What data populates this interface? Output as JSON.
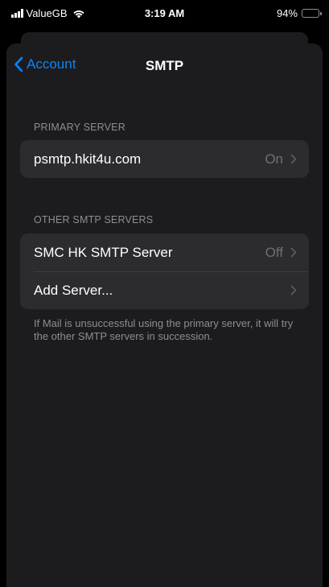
{
  "status_bar": {
    "carrier": "ValueGB",
    "time": "3:19 AM",
    "battery": "94%",
    "battery_level": 0.94
  },
  "nav": {
    "back_label": "Account",
    "title": "SMTP"
  },
  "primary_section": {
    "header": "PRIMARY SERVER",
    "rows": [
      {
        "label": "psmtp.hkit4u.com",
        "value": "On"
      }
    ]
  },
  "other_section": {
    "header": "OTHER SMTP SERVERS",
    "rows": [
      {
        "label": "SMC HK SMTP Server",
        "value": "Off"
      },
      {
        "label": "Add Server...",
        "value": ""
      }
    ],
    "footer": "If Mail is unsuccessful using the primary server, it will try the other SMTP servers in succession."
  },
  "colors": {
    "accent": "#0a84ff",
    "background": "#000000",
    "sheet": "#1c1c1e",
    "cell": "#2c2c2e",
    "secondary_text": "#8d8d93"
  },
  "icons": {
    "back": "chevron-left-icon",
    "disclosure": "chevron-right-icon",
    "signal": "cellular-signal-icon",
    "wifi": "wifi-icon",
    "battery": "battery-icon"
  }
}
